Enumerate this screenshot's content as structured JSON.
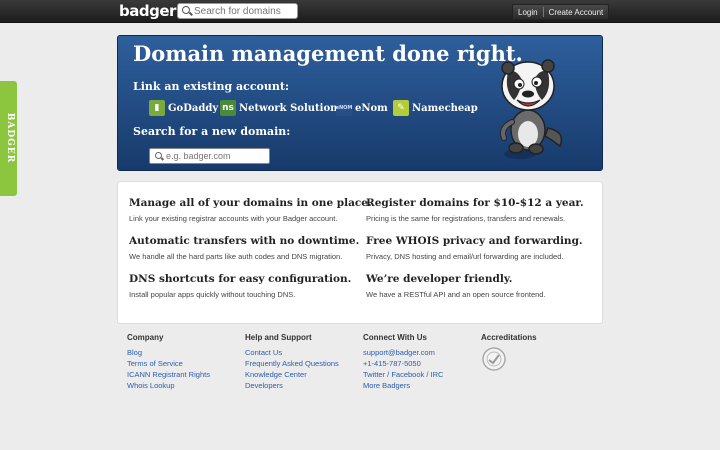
{
  "header": {
    "logo": "badger",
    "search_placeholder": "Search for domains",
    "login": "Login",
    "create_account": "Create Account"
  },
  "side_tab": "BADGER",
  "hero": {
    "title": "Domain management done right.",
    "link_label": "Link an existing account:",
    "registrars": [
      {
        "name": "GoDaddy",
        "icon": "godaddy-icon",
        "color": "#7aa93c"
      },
      {
        "name": "Network Solutions",
        "icon": "network-solutions-icon",
        "color": "#4c8a3a"
      },
      {
        "name": "eNom",
        "icon": "enom-icon",
        "color": "#2a4f86"
      },
      {
        "name": "Namecheap",
        "icon": "namecheap-icon",
        "color": "#b5cc3a"
      }
    ],
    "search_label": "Search for a new domain:",
    "search_placeholder": "e.g. badger.com"
  },
  "features": [
    {
      "title": "Manage all of your domains in one place.",
      "desc": "Link your existing registrar accounts with your Badger account."
    },
    {
      "title": "Register domains for $10-$12 a year.",
      "desc": "Pricing is the same for registrations, transfers and renewals."
    },
    {
      "title": "Automatic transfers with no downtime.",
      "desc": "We handle all the hard parts like auth codes and DNS migration."
    },
    {
      "title": "Free WHOIS privacy and forwarding.",
      "desc": "Privacy, DNS hosting and email/url forwarding are included."
    },
    {
      "title": "DNS shortcuts for easy configuration.",
      "desc": "Install popular apps quickly without touching DNS."
    },
    {
      "title": "We’re developer friendly.",
      "desc": "We have a RESTful API and an open source frontend."
    }
  ],
  "footer": {
    "company": {
      "heading": "Company",
      "links": [
        "Blog",
        "Terms of Service",
        "ICANN Registrant Rights",
        "Whois Lookup"
      ]
    },
    "help": {
      "heading": "Help and Support",
      "links": [
        "Contact Us",
        "Frequently Asked Questions",
        "Knowledge Center",
        "Developers"
      ]
    },
    "connect": {
      "heading": "Connect With Us",
      "links": [
        "support@badger.com",
        "+1-415-787-5050",
        "Twitter / Facebook / IRC",
        "More Badgers"
      ]
    },
    "accreditations": {
      "heading": "Accreditations",
      "badge": "icann-seal-icon"
    }
  },
  "colors": {
    "accent_green": "#8cc63f",
    "hero_blue": "#2e5f9c",
    "link": "#2a5db0"
  }
}
